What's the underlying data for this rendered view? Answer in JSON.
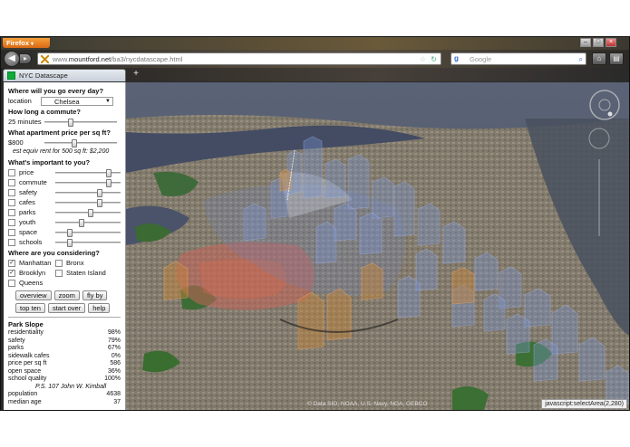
{
  "browser": {
    "menu_label": "Firefox",
    "url_prefix": "www.",
    "url_domain": "mountford.net",
    "url_path": "/ba3/nycdatascape.html",
    "search_placeholder": "Google",
    "tab_title": "NYC Datascape",
    "new_tab": "+"
  },
  "form": {
    "q_location": "Where will you go every day?",
    "location_label": "location",
    "location_value": "Chelsea",
    "q_commute": "How long a commute?",
    "commute_value": "25 minutes",
    "commute_fraction": 0.35,
    "q_price": "What apartment price per sq ft?",
    "price_value": "$800",
    "price_fraction": 0.4,
    "rent_note": "est equiv rent for 500 sq ft: $2,200",
    "q_important": "What's important to you?",
    "importance": [
      {
        "label": "price",
        "level": 0.85,
        "checked": false
      },
      {
        "label": "commute",
        "level": 0.85,
        "checked": false
      },
      {
        "label": "safety",
        "level": 0.7,
        "checked": false
      },
      {
        "label": "cafes",
        "level": 0.7,
        "checked": false
      },
      {
        "label": "parks",
        "level": 0.55,
        "checked": false
      },
      {
        "label": "youth",
        "level": 0.4,
        "checked": false
      },
      {
        "label": "space",
        "level": 0.2,
        "checked": false
      },
      {
        "label": "schools",
        "level": 0.2,
        "checked": false
      }
    ],
    "q_boroughs": "Where are you considering?",
    "boroughs": [
      {
        "label": "Manhattan",
        "checked": true
      },
      {
        "label": "Bronx",
        "checked": false
      },
      {
        "label": "Brooklyn",
        "checked": true
      },
      {
        "label": "Staten Island",
        "checked": false
      },
      {
        "label": "Queens",
        "checked": false
      }
    ],
    "buttons": {
      "overview": "overview",
      "zoom": "zoom",
      "fly_by": "fly by",
      "top_ten": "top ten",
      "start_over": "start over",
      "help": "help"
    }
  },
  "neighborhood": {
    "name": "Park Slope",
    "stats": [
      {
        "label": "residentiality",
        "value": "98%"
      },
      {
        "label": "safety",
        "value": "79%"
      },
      {
        "label": "parks",
        "value": "67%"
      },
      {
        "label": "sidewalk cafes",
        "value": "0%"
      },
      {
        "label": "price per sq ft",
        "value": "586"
      },
      {
        "label": "open space",
        "value": "36%"
      },
      {
        "label": "school quality",
        "value": "100%"
      }
    ],
    "school_name": "P.S. 107 John W. Kimball",
    "stats2": [
      {
        "label": "population",
        "value": "4638"
      },
      {
        "label": "median age",
        "value": "37"
      }
    ]
  },
  "map": {
    "credits": "© Data SIO, NOAA, U.S. Navy, NGA, GEBCO",
    "status_text": "javascript:selectArea(2,280)"
  }
}
